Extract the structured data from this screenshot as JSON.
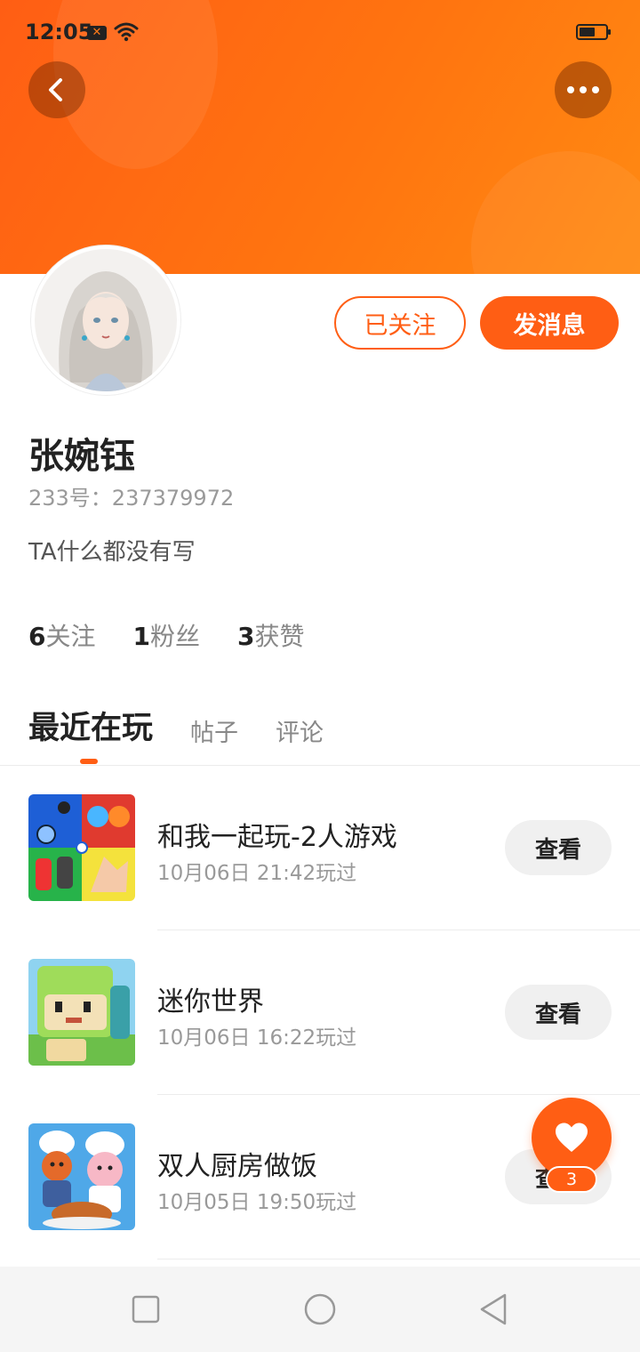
{
  "status_bar": {
    "time": "12:05",
    "sim_label": "✕"
  },
  "header": {
    "back_icon": "chevron-left-icon",
    "more_icon": "more-dots-icon",
    "background_color": "#ff6a10"
  },
  "profile": {
    "name": "张婉钰",
    "id_line": "233号：237379972",
    "bio": "TA什么都没有写",
    "follow_button_label": "已关注",
    "message_button_label": "发消息",
    "stats": [
      {
        "value": "6",
        "label": "关注"
      },
      {
        "value": "1",
        "label": "粉丝"
      },
      {
        "value": "3",
        "label": "获赞"
      }
    ]
  },
  "tabs": [
    {
      "label": "最近在玩",
      "active": true
    },
    {
      "label": "帖子",
      "active": false
    },
    {
      "label": "评论",
      "active": false
    }
  ],
  "games": [
    {
      "name": "和我一起玩-2人游戏",
      "played": "10月06日 21:42玩过",
      "action": "查看"
    },
    {
      "name": "迷你世界",
      "played": "10月06日 16:22玩过",
      "action": "查看"
    },
    {
      "name": "双人厨房做饭",
      "played": "10月05日 19:50玩过",
      "action": "查看"
    }
  ],
  "like_fab": {
    "icon": "heart-icon",
    "count": "3"
  },
  "nav_bar": {
    "items": [
      "recents-icon",
      "home-icon",
      "back-triangle-icon"
    ]
  },
  "colors": {
    "accent": "#ff5e14"
  }
}
